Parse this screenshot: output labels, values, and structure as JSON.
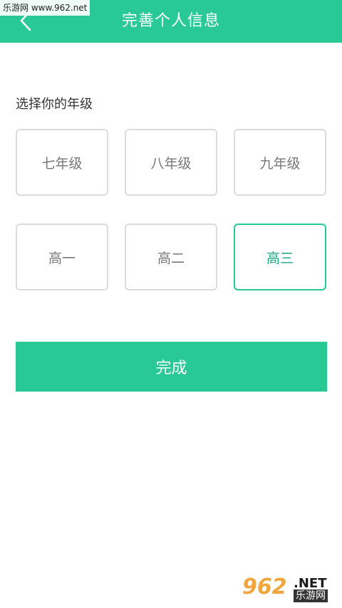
{
  "header": {
    "title": "完善个人信息",
    "back_icon": "chevron-left-icon"
  },
  "watermark": {
    "top_text": "乐游网 www.962.net",
    "bottom_number": "962",
    "bottom_domain": ".NET",
    "bottom_cn": "乐游网"
  },
  "grade_section": {
    "label": "选择你的年级",
    "options": [
      {
        "label": "七年级",
        "selected": false
      },
      {
        "label": "八年级",
        "selected": false
      },
      {
        "label": "九年级",
        "selected": false
      },
      {
        "label": "高一",
        "selected": false
      },
      {
        "label": "高二",
        "selected": false
      },
      {
        "label": "高三",
        "selected": true
      }
    ]
  },
  "actions": {
    "done_label": "完成"
  },
  "colors": {
    "accent": "#29c996",
    "selected_text": "#1aa57d",
    "border": "#dcdcdc",
    "option_text": "#777777"
  }
}
